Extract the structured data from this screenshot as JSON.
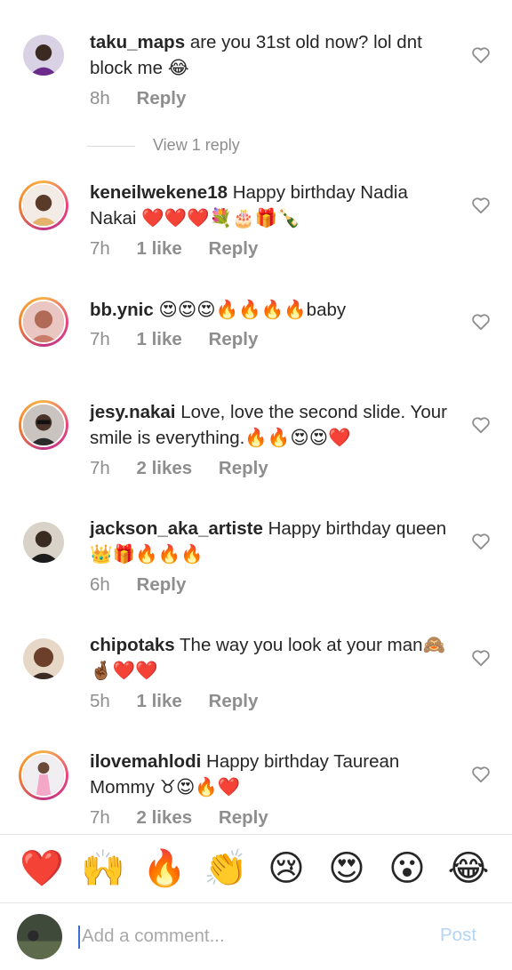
{
  "colors": {
    "text": "#262626",
    "muted": "#8e8e8e",
    "post_disabled": "#b3d4f5",
    "heart": "#e0245e"
  },
  "comments": [
    {
      "username": "taku_maps",
      "text": "are you 31st old now? lol dnt block me 😂",
      "time": "8h",
      "likes": "",
      "reply": "Reply",
      "avatar_ring": false
    },
    {
      "username": "keneilwekene18",
      "text": "Happy birthday Nadia Nakai ❤️❤️❤️💐🎂🎁🍾",
      "time": "7h",
      "likes": "1 like",
      "reply": "Reply",
      "avatar_ring": true
    },
    {
      "username": "bb.ynic",
      "text": "😍😍😍🔥🔥🔥🔥baby",
      "time": "7h",
      "likes": "1 like",
      "reply": "Reply",
      "avatar_ring": true
    },
    {
      "username": "jesy.nakai",
      "text": "Love, love the second slide. Your smile is everything.🔥🔥😍😍❤️",
      "time": "7h",
      "likes": "2 likes",
      "reply": "Reply",
      "avatar_ring": true
    },
    {
      "username": "jackson_aka_artiste",
      "text": "Happy birthday queen 👑🎁🔥🔥🔥",
      "time": "6h",
      "likes": "",
      "reply": "Reply",
      "avatar_ring": false
    },
    {
      "username": "chipotaks",
      "text": "The way you look at your man🙈🤞🏾❤️❤️",
      "time": "5h",
      "likes": "1 like",
      "reply": "Reply",
      "avatar_ring": false
    },
    {
      "username": "ilovemahlodi",
      "text": "Happy birthday Taurean Mommy ♉😍🔥❤️",
      "time": "7h",
      "likes": "2 likes",
      "reply": "Reply",
      "avatar_ring": true
    }
  ],
  "view_replies": "View 1 reply",
  "emoji_reactions": [
    "❤️",
    "🙌",
    "🔥",
    "👏",
    "😢",
    "😍",
    "😮",
    "😂"
  ],
  "comment_input": {
    "placeholder": "Add a comment...",
    "value": ""
  },
  "post_label": "Post",
  "icons": {
    "like": "heart-outline-icon"
  }
}
